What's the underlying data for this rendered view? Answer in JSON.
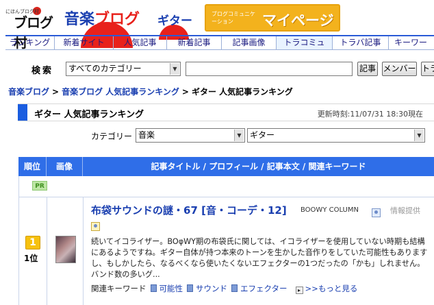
{
  "header": {
    "village_small": "にほんブログ村",
    "village_logo": "ブログ村",
    "music_logo_blue": "音楽",
    "music_logo_red": "ブログ",
    "guitar_logo": "ギター",
    "mypage_sub": "ブログコミュニケーション",
    "mypage_main": "マイページ"
  },
  "nav": {
    "tabs": [
      {
        "label": "ランキング"
      },
      {
        "label": "新着サイト"
      },
      {
        "label": "人気記事"
      },
      {
        "label": "新着記事"
      },
      {
        "label": "記事画像"
      },
      {
        "label": "トラコミュ"
      },
      {
        "label": "トラバ記事"
      },
      {
        "label": "キーワー"
      }
    ]
  },
  "search": {
    "label": "検索",
    "category_selected": "すべてのカテゴリー",
    "query_value": "",
    "buttons": {
      "articles": "記事",
      "members": "メンバー",
      "more": "トラ"
    }
  },
  "breadcrumb": {
    "items": [
      "音楽ブログ",
      "音楽ブログ 人気記事ランキング"
    ],
    "separator": ">",
    "current": "ギター 人気記事ランキング"
  },
  "heading": {
    "title": "ギター 人気記事ランキング",
    "updated": "更新時刻:11/07/31 18:30現在"
  },
  "category_filter": {
    "label": "カテゴリー",
    "primary": "音楽",
    "secondary": "ギター"
  },
  "table": {
    "headers": {
      "rank": "順位",
      "image": "画像",
      "content": "記事タイトル / プロフィール / 記事本文 / 関連キーワード"
    },
    "pr_label": "PR",
    "rows": [
      {
        "rank_icon": "1",
        "rank": "1位",
        "title": "布袋サウンドの謎・67 [音・コーデ・12]",
        "blog": "BOOWY COLUMN",
        "info": "情報提供",
        "excerpt": "続いてイコライザー。BOφWY期の布袋氏に関しては、イコライザーを使用していない時期も結構にあるようですね。ギター自体が持つ本来のトーンを生かした音作りをしていた可能性もありますし、もしかしたら、なるべくなら使いたくないエフェクターの1つだったの「かも」しれません。バンド数の多いグ...",
        "related_label": "関連キーワード",
        "keywords": [
          "可能性",
          "サウンド",
          "エフェクター"
        ],
        "more": ">>もっと見る"
      }
    ]
  },
  "colors": {
    "accent": "#2f6ee8",
    "link": "#1a3fb0",
    "logo_red": "#e8211b",
    "mypage_orange": "#f3b21d"
  }
}
